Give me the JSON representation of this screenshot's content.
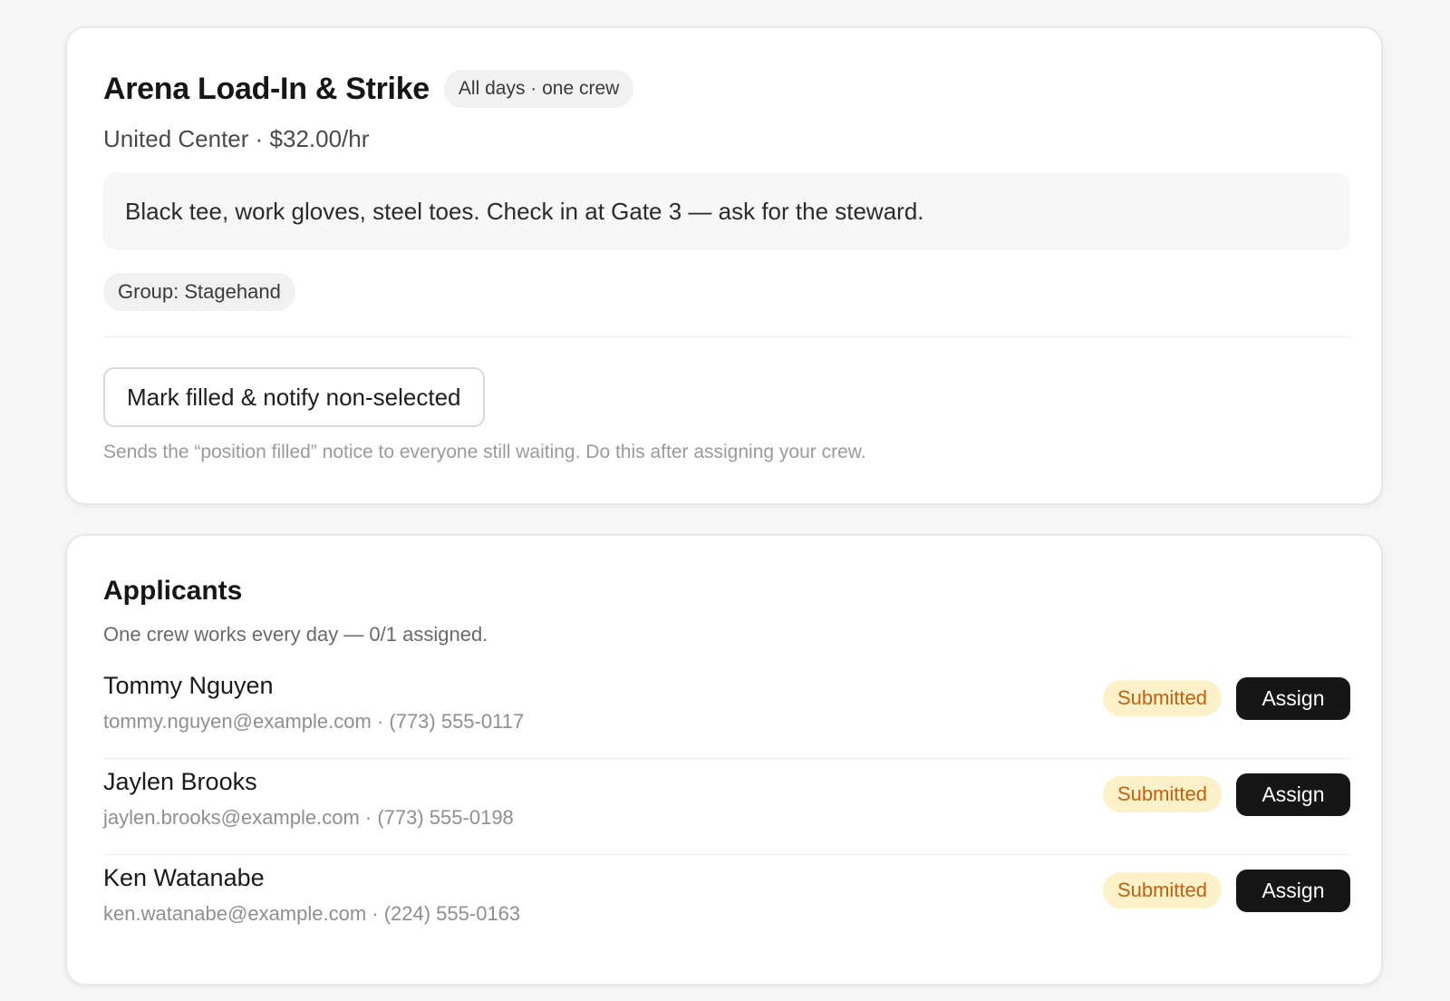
{
  "job": {
    "title": "Arena Load-In & Strike",
    "schedule_pill": "All days · one crew",
    "subtitle": "United Center · $32.00/hr",
    "notes": "Black tee, work gloves, steel toes. Check in at Gate 3 — ask for the steward.",
    "group_tag": "Group: Stagehand",
    "mark_filled_label": "Mark filled & notify non-selected",
    "helper_text": "Sends the “position filled” notice to everyone still waiting. Do this after assigning your crew."
  },
  "applicants": {
    "title": "Applicants",
    "subtitle": "One crew works every day — 0/1 assigned.",
    "items": [
      {
        "name": "Tommy Nguyen",
        "contact": "tommy.nguyen@example.com · (773) 555-0117",
        "status": "Submitted",
        "action_label": "Assign"
      },
      {
        "name": "Jaylen Brooks",
        "contact": "jaylen.brooks@example.com · (773) 555-0198",
        "status": "Submitted",
        "action_label": "Assign"
      },
      {
        "name": "Ken Watanabe",
        "contact": "ken.watanabe@example.com · (224) 555-0163",
        "status": "Submitted",
        "action_label": "Assign"
      }
    ]
  },
  "colors": {
    "status_submitted_bg": "#fdf1c9",
    "status_submitted_text": "#c2610c",
    "primary_button": "#161616"
  }
}
